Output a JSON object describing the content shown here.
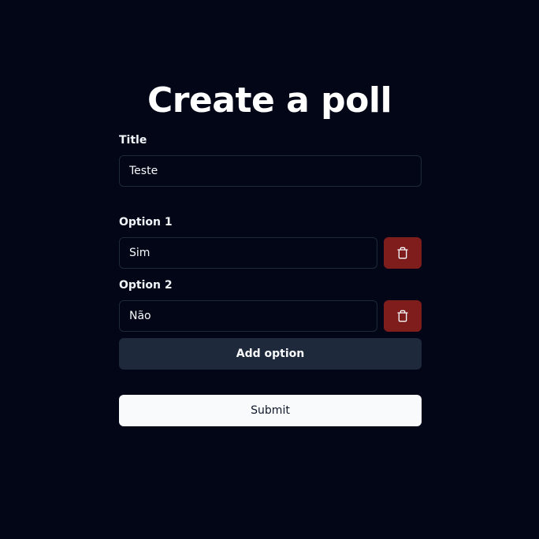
{
  "page": {
    "heading": "Create a poll"
  },
  "form": {
    "title_label": "Title",
    "title_value": "Teste",
    "options": [
      {
        "label": "Option 1",
        "value": "Sim",
        "delete_icon": "trash-icon"
      },
      {
        "label": "Option 2",
        "value": "Não",
        "delete_icon": "trash-icon"
      }
    ],
    "add_option_label": "Add option",
    "submit_label": "Submit"
  },
  "colors": {
    "background": "#020617",
    "input_border": "#1e293b",
    "delete_button": "#7f1d1d",
    "add_button": "#1e293b",
    "submit_button": "#f8fafc",
    "submit_text": "#0f172a"
  }
}
